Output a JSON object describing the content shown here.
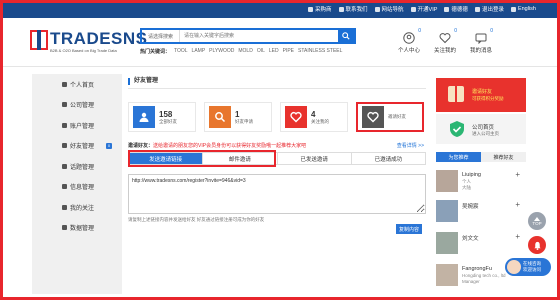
{
  "topbar": {
    "links": [
      {
        "label": "采购商",
        "icon": "user-icon"
      },
      {
        "label": "联系我们",
        "icon": "phone-icon"
      },
      {
        "label": "网站导航",
        "icon": "menu-icon"
      },
      {
        "label": "开通VIP",
        "icon": "crown-icon"
      },
      {
        "label": "德德德",
        "icon": "person-icon"
      },
      {
        "label": "退出登录",
        "icon": "logout-icon"
      },
      {
        "label": "English",
        "icon": "flag-icon"
      }
    ]
  },
  "header": {
    "logo_text": "TRADESNS",
    "logo_sub": "B2B & O2O Based on Big Trade Data",
    "search_select": "请选择搜索",
    "search_placeholder": "请在输入关键字后搜索",
    "hot_label": "热门关键词：",
    "hot_keywords": [
      "TOOL",
      "LAMP",
      "PLYWOOD",
      "MOLD",
      "OIL",
      "LED",
      "PIPE",
      "STAINLESS STEEL"
    ],
    "user_icons": [
      {
        "label": "个人中心",
        "count": "0",
        "icon": "account-icon"
      },
      {
        "label": "关注我的",
        "count": "0",
        "icon": "heart-icon"
      },
      {
        "label": "我的消息",
        "count": "0",
        "icon": "message-icon"
      }
    ]
  },
  "sidebar": {
    "items": [
      {
        "label": "个人首页",
        "icon": "home-icon"
      },
      {
        "label": "公司管理",
        "icon": "company-icon"
      },
      {
        "label": "账户管理",
        "icon": "account-icon"
      },
      {
        "label": "好友管理",
        "icon": "friends-icon",
        "badge": "0"
      },
      {
        "label": "话题管理",
        "icon": "topic-icon"
      },
      {
        "label": "信息管理",
        "icon": "info-icon"
      },
      {
        "label": "我的关注",
        "icon": "follow-icon"
      },
      {
        "label": "数据管理",
        "icon": "data-icon"
      }
    ]
  },
  "main": {
    "section_title": "好友管理",
    "stats": [
      {
        "value": "158",
        "label": "全部好友",
        "color": "#2a75d6",
        "icon": "users-icon"
      },
      {
        "value": "1",
        "label": "好友申请",
        "color": "#e8762d",
        "icon": "search-icon"
      },
      {
        "value": "4",
        "label": "关注我的",
        "color": "#e8322d",
        "icon": "heart-icon"
      },
      {
        "value": "",
        "label": "邀请好友",
        "color": "#555555",
        "icon": "heart-icon"
      }
    ],
    "invite_label": "邀请好友：",
    "invite_text": "送给邀请的朋友您的VIP会员身份可以获得好友奖励哦一起推荐大家吧",
    "invite_more": "查看详情 >>",
    "tabs": [
      "发送邀请链接",
      "邮件邀请",
      "已发送邀请",
      "已邀请成功"
    ],
    "link_value": "http://www.tradesns.com/register?invite=946&vid=3",
    "hint": "请复制上述链接内容并发送给好友 好友通过链接注册可成为你的好友",
    "copy_button": "复制内容"
  },
  "right": {
    "card1_title": "邀请好友",
    "card1_sub": "可获得积分奖励",
    "card2_title": "公司首页",
    "card2_sub": "进入公司主页",
    "tabs": [
      "为您推荐",
      "推荐好友"
    ],
    "people": [
      {
        "name": "Liuiping",
        "line1": "个人",
        "line2": "大陆"
      },
      {
        "name": "吴婉宸",
        "line1": "",
        "line2": ""
      },
      {
        "name": "刘文文",
        "line1": "",
        "line2": ""
      },
      {
        "name": "FangrongFu",
        "line1": "Hongding tech co., ltd",
        "line2": "Manager"
      }
    ]
  },
  "fab": {
    "top_label": "TOP",
    "chat_line1": "在线咨询",
    "chat_line2": "欢迎访问"
  }
}
